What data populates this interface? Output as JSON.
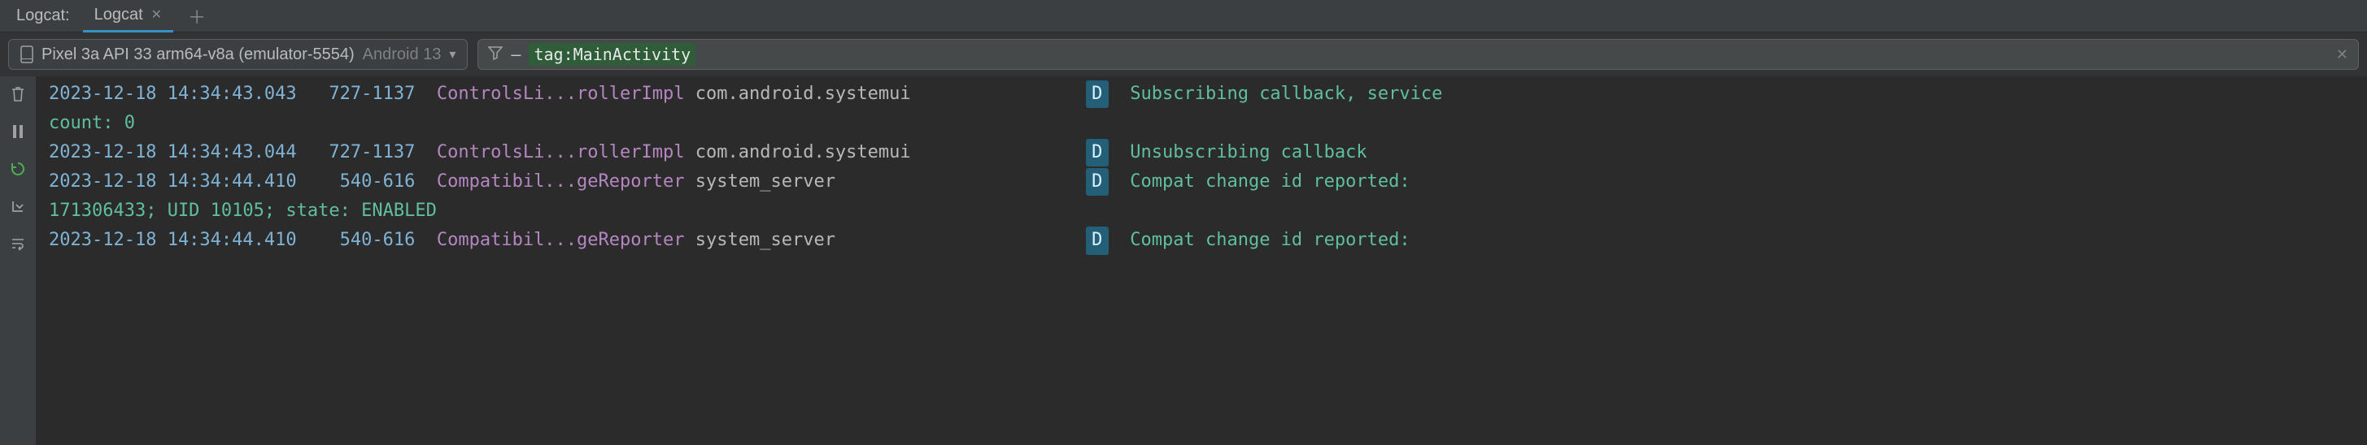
{
  "tabs": {
    "panel_title": "Logcat:",
    "active_tab": "Logcat"
  },
  "device": {
    "name": "Pixel 3a API 33 arm64-v8a (emulator-5554)",
    "android": "Android 13"
  },
  "filter": {
    "prefix": "–",
    "value": "tag:MainActivity"
  },
  "logs": [
    {
      "ts": "2023-12-18 14:34:43.043",
      "pid": "727-1137",
      "tag": "ControlsLi...rollerImpl",
      "pkg": "com.android.systemui",
      "level": "D",
      "msg": "Subscribing callback, service",
      "wrap": "count: 0"
    },
    {
      "ts": "2023-12-18 14:34:43.044",
      "pid": "727-1137",
      "tag": "ControlsLi...rollerImpl",
      "pkg": "com.android.systemui",
      "level": "D",
      "msg": "Unsubscribing callback",
      "wrap": ""
    },
    {
      "ts": "2023-12-18 14:34:44.410",
      "pid": "540-616",
      "tag": "Compatibil...geReporter",
      "pkg": "system_server",
      "level": "D",
      "msg": "Compat change id reported:",
      "wrap": "171306433; UID 10105; state: ENABLED"
    },
    {
      "ts": "2023-12-18 14:34:44.410",
      "pid": "540-616",
      "tag": "Compatibil...geReporter",
      "pkg": "system_server",
      "level": "D",
      "msg": "Compat change id reported:",
      "wrap": ""
    }
  ]
}
